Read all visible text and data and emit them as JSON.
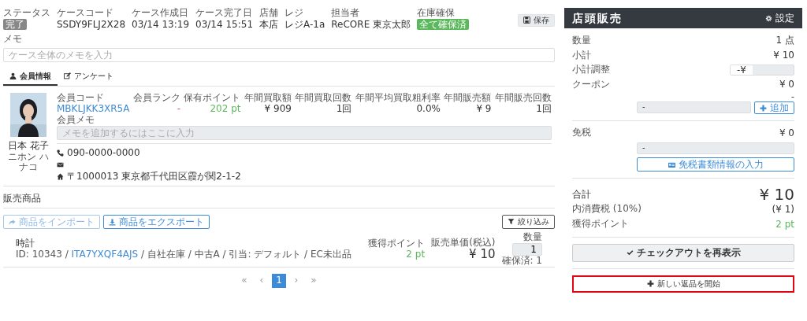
{
  "case": {
    "fields": [
      {
        "label": "ステータス",
        "value": "完了",
        "kind": "badge-gray"
      },
      {
        "label": "ケースコード",
        "value": "SSDY9FLJ2X28",
        "kind": "plain"
      },
      {
        "label": "ケース作成日",
        "value": "03/14 13:19",
        "kind": "plain"
      },
      {
        "label": "ケース完了日",
        "value": "03/14 15:51",
        "kind": "plain"
      },
      {
        "label": "店舗",
        "value": "本店",
        "kind": "plain"
      },
      {
        "label": "レジ",
        "value": "レジA-1a",
        "kind": "plain"
      },
      {
        "label": "担当者",
        "value": "ReCORE 東京太郎",
        "kind": "plain"
      },
      {
        "label": "在庫確保",
        "value": "全て確保済",
        "kind": "badge-green"
      }
    ],
    "save_button": "保存",
    "memo_label": "メモ",
    "memo_placeholder": "ケース全体のメモを入力"
  },
  "tabs": [
    {
      "label": "会員情報",
      "selected": true
    },
    {
      "label": "アンケート",
      "selected": false
    }
  ],
  "member": {
    "name": "日本 花子",
    "kana": "ニホン ハナコ",
    "stats": [
      {
        "label": "会員コード",
        "value": "MBKLJKK3XR5A",
        "kind": "link"
      },
      {
        "label": "会員ランク",
        "value": "-",
        "kind": "danger"
      },
      {
        "label": "保有ポイント",
        "value": "202 pt",
        "kind": "points"
      },
      {
        "label": "年間買取額",
        "value": "¥ 909",
        "kind": "plain"
      },
      {
        "label": "年間買取回数",
        "value": "1回",
        "kind": "plain"
      },
      {
        "label": "年間平均買取粗利率",
        "value": "0.0%",
        "kind": "plain"
      },
      {
        "label": "年間販売額",
        "value": "¥ 9",
        "kind": "plain"
      },
      {
        "label": "年間販売回数",
        "value": "1回",
        "kind": "plain"
      }
    ],
    "memo_label": "会員メモ",
    "memo_placeholder": "メモを追加するにはここに入力",
    "phone": "090-0000-0000",
    "address": "〒1000013 東京都千代田区霞が関2-1-2"
  },
  "sales": {
    "title": "販売商品",
    "import_button": "商品をインポート",
    "export_button": "商品をエクスポート",
    "filter_button": "絞り込み",
    "items": [
      {
        "name": "時計",
        "meta": "ID: 10343 / ",
        "code": "ITA7YXQF4AJS",
        "meta_rest": " / 自社在庫 / 中古A / 引当: デフォルト / EC未出品",
        "points_label": "獲得ポイント",
        "points": "2 pt",
        "price_label": "販売単価(税込)",
        "price": "¥ 10",
        "qty_label": "数量",
        "qty": "1",
        "reserved": "確保済: 1"
      }
    ],
    "pagination": [
      {
        "label": "«",
        "selected": false
      },
      {
        "label": "‹",
        "selected": false
      },
      {
        "label": "1",
        "selected": true
      },
      {
        "label": "›",
        "selected": false
      },
      {
        "label": "»",
        "selected": false
      }
    ]
  },
  "register": {
    "title": "店頭販売",
    "settings": "設定",
    "rows": [
      {
        "label": "数量",
        "value": "1 点",
        "kind": "value"
      },
      {
        "label": "小計",
        "value": "¥ 10",
        "kind": "value"
      },
      {
        "label": "小計調整",
        "value": "-¥",
        "kind": "input"
      },
      {
        "label": "クーポン",
        "value": "¥ 0",
        "kind": "value"
      }
    ],
    "coupon_note": "-",
    "coupon_select": "-",
    "coupon_add": "追加",
    "tax_free_label": "免税",
    "tax_free_value": "¥ 0",
    "tax_free_select": "-",
    "tax_free_button": "免税書類情報の入力",
    "total_label": "合計",
    "total": "¥ 10",
    "tax_label": "内消費税 (10%)",
    "tax": "(¥ 1)",
    "points_label": "獲得ポイント",
    "points": "2 pt",
    "checkout_button": "チェックアウトを再表示",
    "new_return_button": "新しい返品を開始",
    "new_return_highlighted": true
  }
}
